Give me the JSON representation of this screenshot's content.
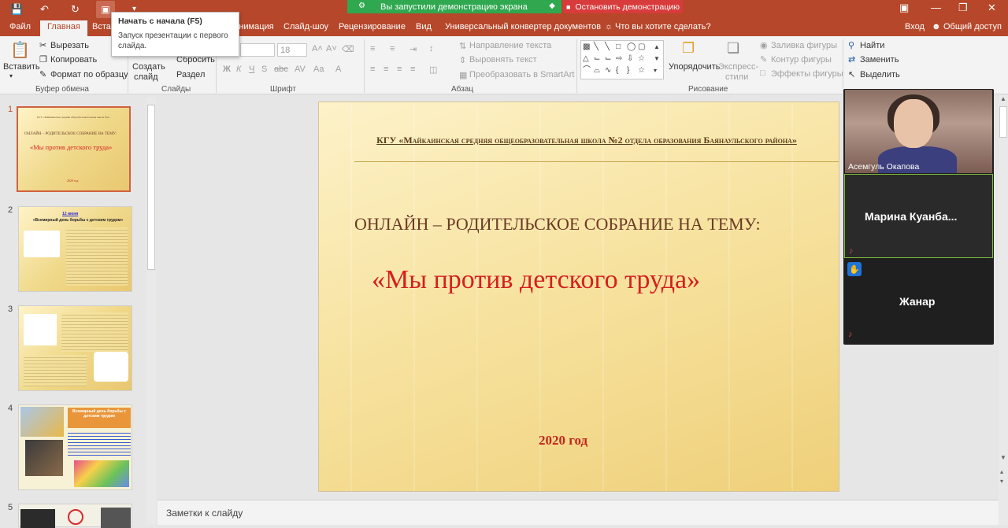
{
  "share": {
    "message": "Вы запустили демонстрацию экрана",
    "stop_label": "Остановить демонстрацию"
  },
  "tooltip": {
    "title": "Начать с начала (F5)",
    "description": "Запуск презентации с первого слайда."
  },
  "tabs": [
    "Файл",
    "Главная",
    "Встав",
    "Анимация",
    "Слайд-шоу",
    "Рецензирование",
    "Вид",
    "Универсальный конвертер документов"
  ],
  "active_tab": "Главная",
  "search_tab": "Что вы хотите сделать?",
  "right_tabs": {
    "login": "Вход",
    "share": "Общий доступ"
  },
  "ribbon": {
    "clipboard": {
      "paste": "Вставить",
      "cut": "Вырезать",
      "copy": "Копировать",
      "format": "Формат по образцу",
      "label": "Буфер обмена"
    },
    "slides": {
      "new_slide": "Создать",
      "new_slide2": "слайд",
      "reset": "Сбросить",
      "section": "Раздел",
      "label": "Слайды"
    },
    "font": {
      "size": "18",
      "label": "Шрифт"
    },
    "paragraph": {
      "text_direction": "Направление текста",
      "align_text": "Выровнять текст",
      "smartart": "Преобразовать в SmartArt",
      "label": "Абзац"
    },
    "drawing": {
      "arrange": "Упорядочить",
      "quick_styles": "Экспресс-",
      "quick_styles2": "стили",
      "fill": "Заливка фигуры",
      "outline": "Контур фигуры",
      "effects": "Эффекты фигуры",
      "label": "Рисование"
    },
    "editing": {
      "find": "Найти",
      "replace": "Заменить",
      "select": "Выделить"
    }
  },
  "thumbnails": {
    "numbers": [
      "1",
      "2",
      "3",
      "4",
      "5"
    ],
    "slide1": {
      "school": "КГУ «Майкаинская средняя общеобразовательная школа №2...",
      "heading": "ОНЛАЙН – РОДИТЕЛЬСКОЕ СОБРАНИЕ НА ТЕМУ:",
      "title": "«Мы против детского труда»",
      "year": "2020 год"
    },
    "slide2": {
      "date": "12 июня",
      "title": "«Всемирный день борьбы с детским трудом»"
    },
    "slide4": {
      "title": "Всемирный день борьбы с детским трудом"
    }
  },
  "slide": {
    "school": "КГУ «Майкаинская средняя общеобразовательная школа №2 отдела образования Баянаульского района»",
    "heading": "ОНЛАЙН – РОДИТЕЛЬСКОЕ СОБРАНИЕ НА ТЕМУ:",
    "title": "«Мы против детского труда»",
    "year": "2020 год"
  },
  "participants": [
    {
      "name": "Асемгуль Окапова"
    },
    {
      "name": "Марина  Куанба..."
    },
    {
      "name": "Жанар"
    }
  ],
  "notes": {
    "placeholder": "Заметки к слайду"
  },
  "colors": {
    "accent": "#b7472a",
    "share_green": "#2fa84f",
    "stop_red": "#d83b3b",
    "title_red": "#d51f1f"
  }
}
